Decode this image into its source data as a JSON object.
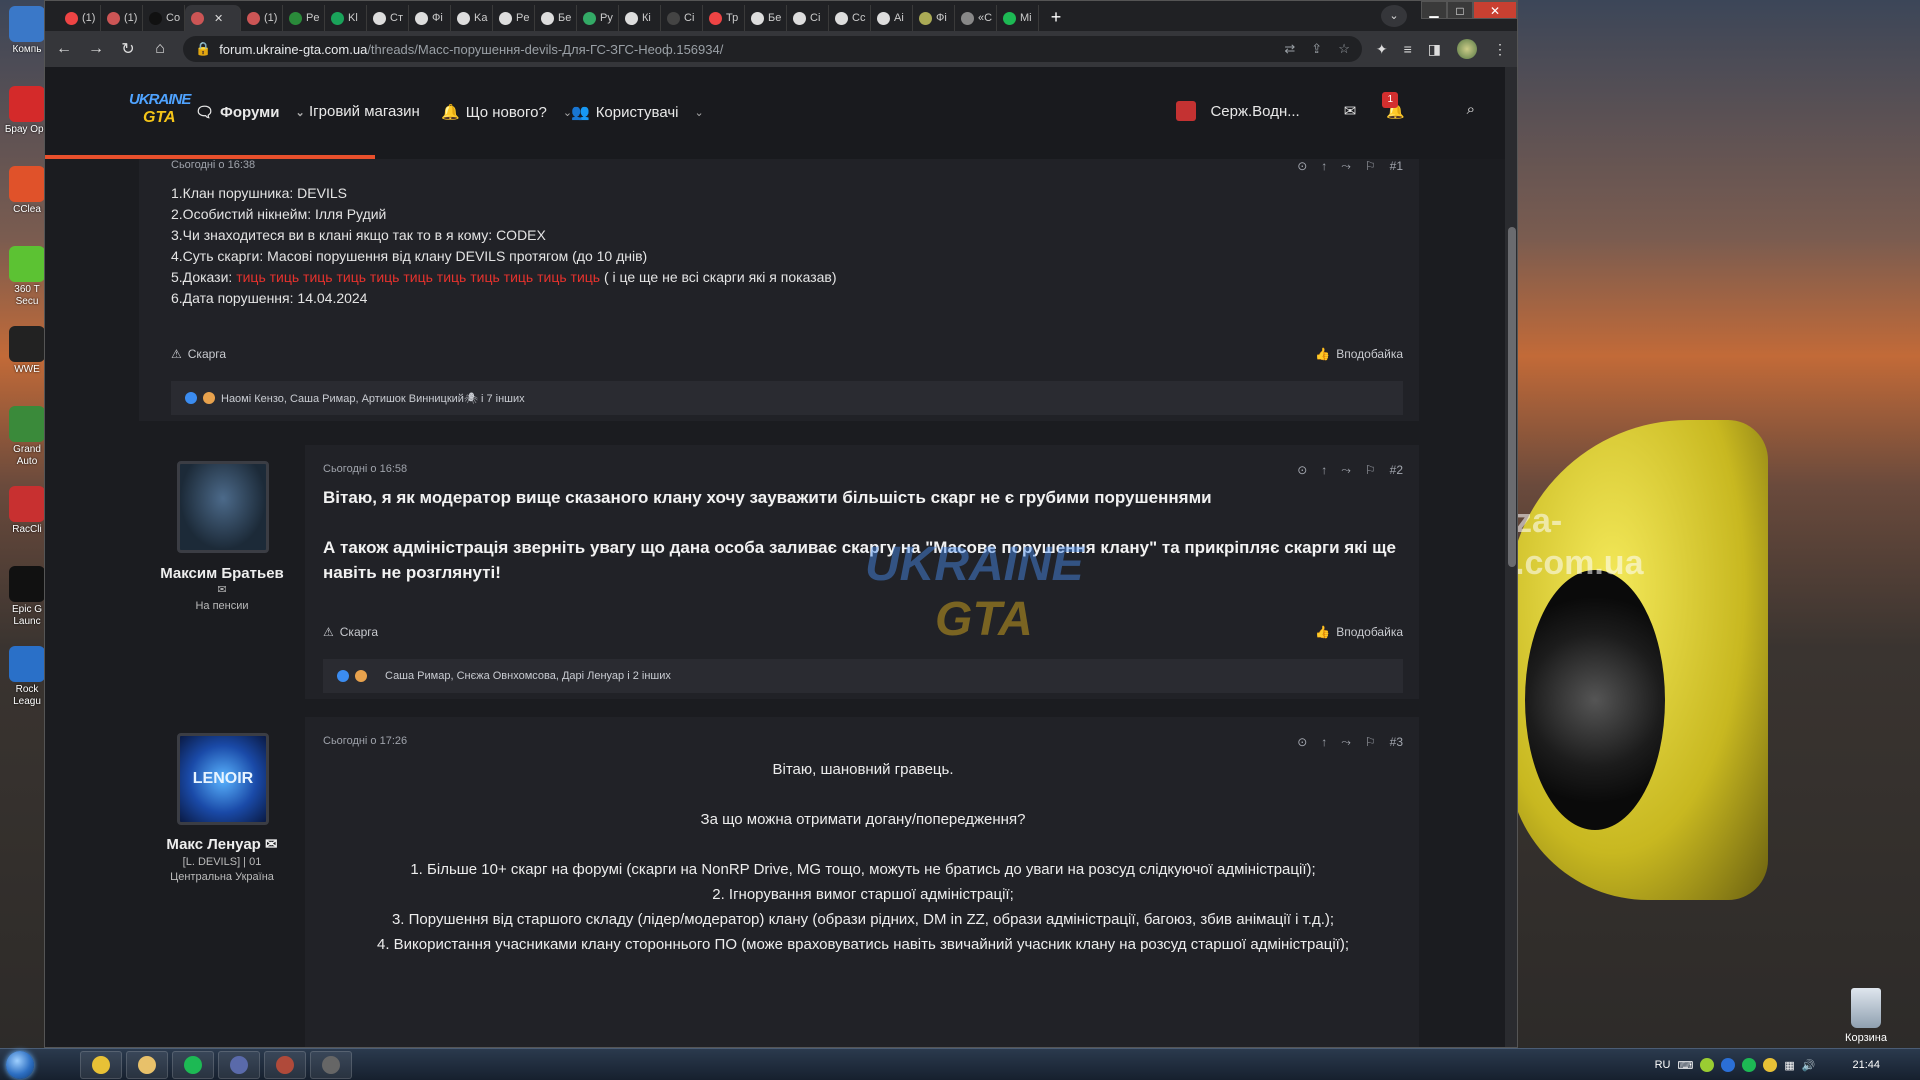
{
  "desktop": {
    "icons": [
      {
        "label": "Компь",
        "color": "#3a78c8"
      },
      {
        "label": "Брау Opе",
        "color": "#d42a2a"
      },
      {
        "label": "CClea",
        "color": "#e0522a"
      },
      {
        "label": "360 T Secu",
        "color": "#5cc233"
      },
      {
        "label": "WWE",
        "color": "#222222"
      },
      {
        "label": "Grand Auto",
        "color": "#3a8a3a"
      },
      {
        "label": "RacCli",
        "color": "#c83030"
      },
      {
        "label": "Epic G Launc",
        "color": "#111111"
      },
      {
        "label": "Rock Leagu",
        "color": "#2a70c8"
      }
    ],
    "recycle_bin": "Корзина",
    "car_text": [
      "za-",
      ".com.ua"
    ]
  },
  "taskbar": {
    "buttons": [
      {
        "name": "chrome",
        "color": "#e8c136"
      },
      {
        "name": "explorer",
        "color": "#e8c16a"
      },
      {
        "name": "spotify",
        "color": "#1db954"
      },
      {
        "name": "app",
        "color": "#5a6aaa"
      },
      {
        "name": "game",
        "color": "#b04a3a"
      },
      {
        "name": "app2",
        "color": "#666666"
      }
    ],
    "tray": {
      "lang": "RU",
      "time": "21:44"
    }
  },
  "browser": {
    "tabs": [
      {
        "label": "(1)",
        "color": "#e44"
      },
      {
        "label": "(1)",
        "color": "#c55"
      },
      {
        "label": "Co",
        "color": "#111"
      },
      {
        "label": "",
        "color": "#c55",
        "active": true
      },
      {
        "label": "(1)",
        "color": "#c55"
      },
      {
        "label": "Pe",
        "color": "#2a8a3a"
      },
      {
        "label": "Kl",
        "color": "#1aa35a"
      },
      {
        "label": "Ст",
        "color": "#ddd"
      },
      {
        "label": "Фі",
        "color": "#ddd"
      },
      {
        "label": "Ka",
        "color": "#ddd"
      },
      {
        "label": "Pe",
        "color": "#ddd"
      },
      {
        "label": "Бе",
        "color": "#ddd"
      },
      {
        "label": "Ру",
        "color": "#3a6"
      },
      {
        "label": "Кі",
        "color": "#ddd"
      },
      {
        "label": "Сі",
        "color": "#444"
      },
      {
        "label": "Тр",
        "color": "#e44"
      },
      {
        "label": "Бе",
        "color": "#ddd"
      },
      {
        "label": "Сі",
        "color": "#ddd"
      },
      {
        "label": "Сс",
        "color": "#ddd"
      },
      {
        "label": "Аі",
        "color": "#ddd"
      },
      {
        "label": "Фі",
        "color": "#aa5"
      },
      {
        "label": "«С",
        "color": "#888"
      },
      {
        "label": "Mi",
        "color": "#1db954"
      }
    ],
    "new_tab": "+",
    "url_host": "forum.ukraine-gta.com.ua",
    "url_path": "/threads/Масс-порушення-devils-Для-ГС-ЗГС-Неоф.156934/",
    "window_controls": [
      "▁",
      "□",
      "✕"
    ]
  },
  "forum": {
    "logo_top": "UKRAINE",
    "logo_bottom": "GTA",
    "nav": {
      "forums": "Форуми",
      "shop": "Ігровий магазин",
      "whats_new": "Що нового?",
      "users": "Користувачі"
    },
    "user": {
      "name": "Серж.Водн...",
      "notif_count": "1"
    },
    "watermark": [
      "UKRAINE",
      "GTA"
    ]
  },
  "posts": [
    {
      "date": "Сьогодні о 16:38",
      "number": "#1",
      "lines": [
        "1.Клан порушника: DEVILS",
        "2.Особистий нікнейм: Ілля Рудий",
        "3.Чи знаходитеся ви в клані якщо так то в я кому: CODEX",
        "4.Суть скарги: Масові порушення від клану DEVILS протягом (до 10 днів)"
      ],
      "proof_label": "5.Докази: ",
      "proof_links": "тиць тиць тиць тиць тиць тиць тиць тиць тиць тиць тиць",
      "proof_note": " ( і це ще не всі скарги які я показав)",
      "date_line": "6.Дата порушення: 14.04.2024",
      "report": "Скарга",
      "like": "Вподобайка",
      "reactions": "Наомі Кензо, Саша Римар, Артишок Винницкий🕷 і 7 інших"
    },
    {
      "author": "Максим Братьев",
      "author_title": "На пенсии",
      "date": "Сьогодні о 16:58",
      "number": "#2",
      "para1": "Вітаю, я як модератор вище сказаного клану хочу зауважити більшість скарг не є грубими порушеннями",
      "para2": "А також адміністрація зверніть увагу що дана особа заливає скаргу на \"Масове порушення клану\" та прикріпляє скарги які ще навіть не розглянуті!",
      "report": "Скарга",
      "like": "Вподобайка",
      "reactions": "Саша Римар, Снєжа Овнхомсова, Дарі Ленуар і 2 інших"
    },
    {
      "author": "Макс Ленуар",
      "author_title": "[L. DEVILS] | 01",
      "author_location": "Центральна Україна",
      "avatar_text": "LENOIR",
      "date": "Сьогодні о 17:26",
      "number": "#3",
      "greeting": "Вітаю, шановний гравець.",
      "question": "За що можна отримати догану/попередження?",
      "rules": [
        "1. Більше 10+ скарг на форумі (скарги на NonRP Drive, MG тощо, можуть не братись до уваги на розсуд слідкуючої адміністрації);",
        "2. Ігнорування вимог старшої адміністрації;",
        "3. Порушення від старшого складу (лідер/модератор) клану (образи рідних, DM in ZZ, образи адміністрації, багоюз, збив анімації і т.д.);",
        "4. Використання учасниками клану стороннього ПО (може враховуватись навіть звичайний учасник клану на розсуд старшої адміністрації);"
      ]
    }
  ]
}
